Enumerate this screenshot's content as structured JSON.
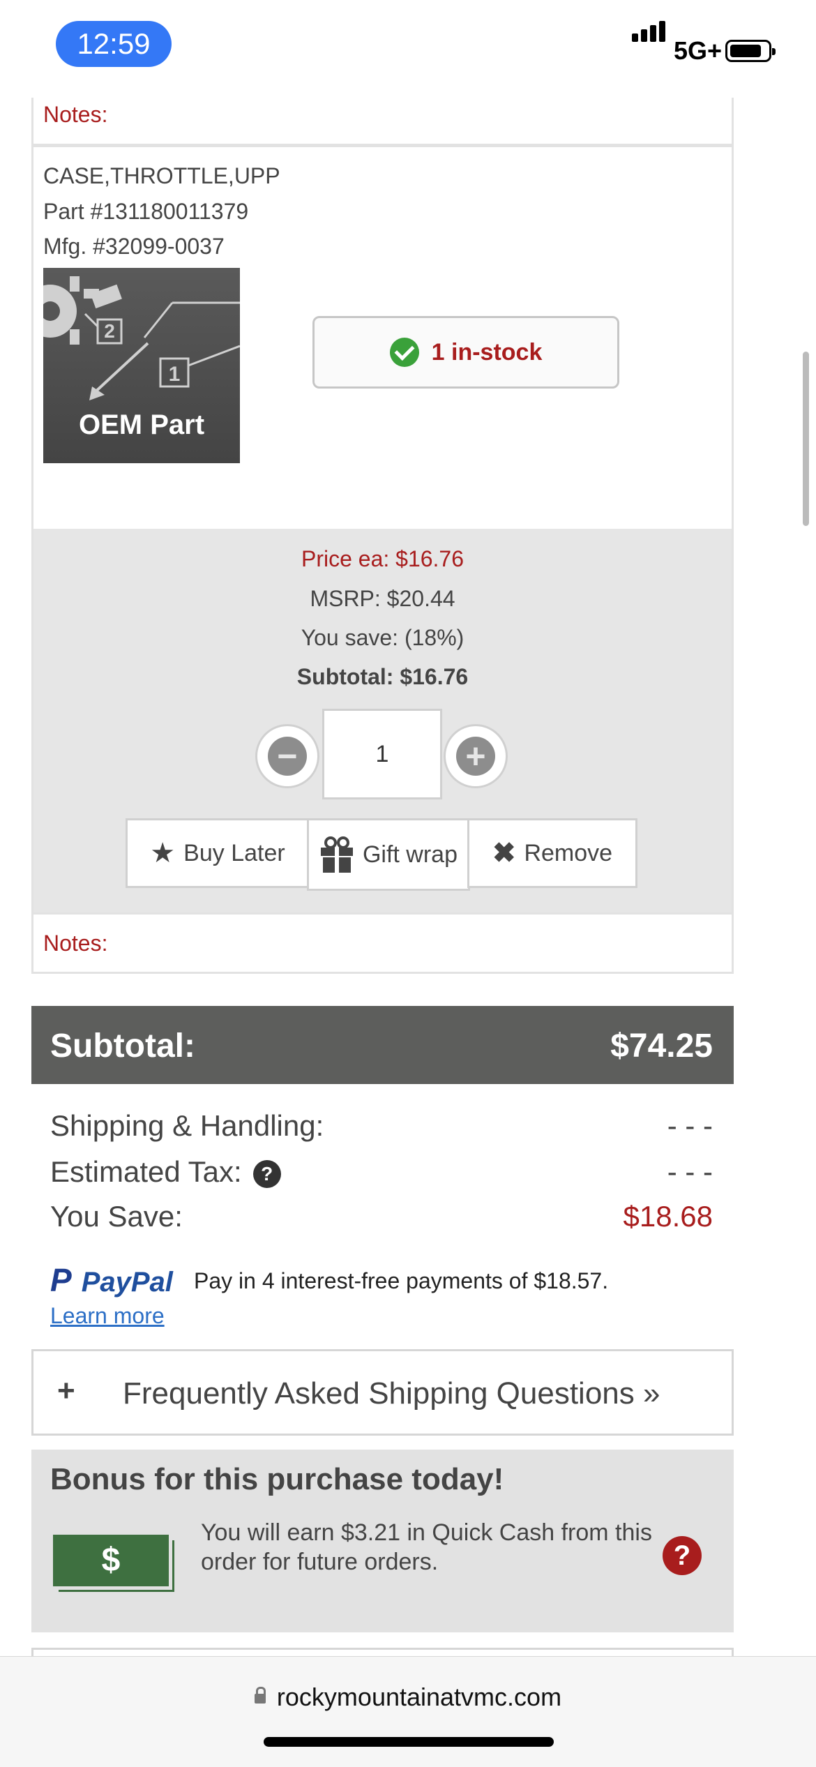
{
  "status_bar": {
    "time": "12:59",
    "network": "5G+"
  },
  "prev_item": {
    "notes_label": "Notes:"
  },
  "item": {
    "name": "CASE,THROTTLE,UPP",
    "part_number": "Part #131180011379",
    "mfg_number": "Mfg. #32099-0037",
    "image_label": "OEM Part",
    "image_callouts": [
      "2",
      "1"
    ],
    "stock": "1 in-stock",
    "price_each": "Price ea: $16.76",
    "msrp": "MSRP: $20.44",
    "you_save": "You save: (18%)",
    "subtotal": "Subtotal: $16.76",
    "quantity": "1",
    "actions": {
      "buy_later": "Buy Later",
      "gift_wrap": "Gift wrap",
      "remove": "Remove"
    },
    "notes_label": "Notes:"
  },
  "summary": {
    "subtotal_label": "Subtotal:",
    "subtotal_value": "$74.25",
    "shipping_label": "Shipping & Handling:",
    "shipping_value": "- - -",
    "tax_label": "Estimated Tax:",
    "tax_value": "- - -",
    "save_label": "You Save:",
    "save_value": "$18.68",
    "save_color": "#a81d1d"
  },
  "paypal": {
    "logo_text": "PayPal",
    "message": "Pay in 4 interest-free payments of $18.57.",
    "learn_more": "Learn more"
  },
  "faq": {
    "icon": "+",
    "label": "Frequently Asked Shipping Questions »"
  },
  "bonus": {
    "title": "Bonus for this purchase today!",
    "cash_symbol": "$",
    "text": "You will earn $3.21 in Quick Cash from this order for future orders."
  },
  "browser": {
    "url": "rockymountainatvmc.com"
  }
}
